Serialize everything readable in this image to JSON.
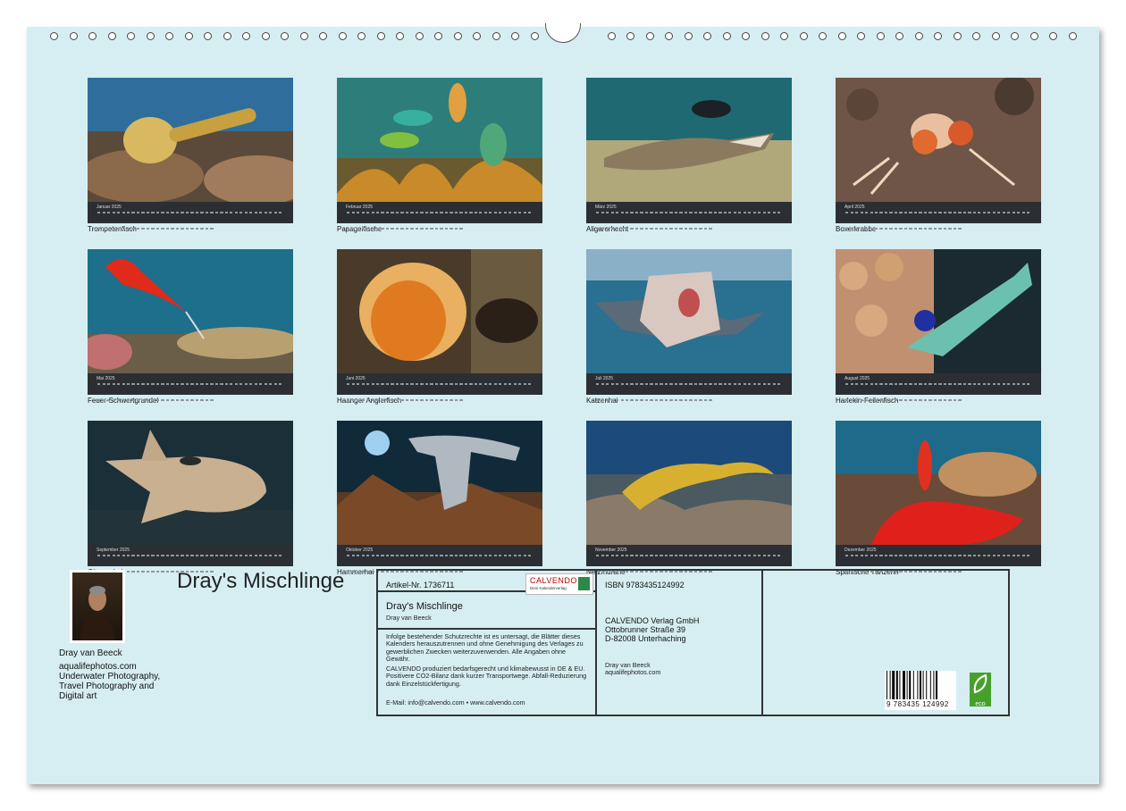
{
  "calendar": {
    "title": "Dray's Mischlinge",
    "months": [
      {
        "name": "Januar 2025",
        "caption": "Trompetenfisch"
      },
      {
        "name": "Februar 2025",
        "caption": "Papageifische"
      },
      {
        "name": "März 2025",
        "caption": "Aligarorhecht"
      },
      {
        "name": "April 2025",
        "caption": "Boxerkrabbe"
      },
      {
        "name": "Mai 2025",
        "caption": "Feuer-Schwertgrundel"
      },
      {
        "name": "Juni 2025",
        "caption": "Haanger Anglerfisch"
      },
      {
        "name": "Juli 2025",
        "caption": "Katzenhai"
      },
      {
        "name": "August 2025",
        "caption": "Harlekin-Feilenfisch"
      },
      {
        "name": "September 2025",
        "caption": "Gitarrenhai"
      },
      {
        "name": "Oktober 2025",
        "caption": "Hammerhai"
      },
      {
        "name": "November 2025",
        "caption": "Netzmuräne"
      },
      {
        "name": "Dezember 2025",
        "caption": "Spanische Tänzerin"
      }
    ]
  },
  "author": {
    "name": "Dray van Beeck",
    "website": "aqualifephotos.com",
    "desc1": "Underwater Photography,",
    "desc2": "Travel Photography and",
    "desc3": "Digital art"
  },
  "info": {
    "artikel": "Artikel-Nr. 1736711",
    "calvendo_name": "CALVENDO",
    "calvendo_sub": "Dein Kalenderverlag",
    "product_title": "Dray's Mischlinge",
    "product_author": "Dray van Beeck",
    "legal1": "Infolge bestehender Schutzrechte ist es untersagt, die Blätter dieses Kalenders herauszutrennen und ohne Genehmigung des Verlages zu gewerblichen Zwecken weiterzuverwenden. Alle Angaben ohne Gewähr.",
    "legal2": "CALVENDO produziert bedarfsgerecht und klimabewusst in DE & EU. Positivere CO2-Bilanz dank kurzer Transportwege. Abfall-Reduzierung dank Einzelstückfertigung.",
    "email": "E-Mail: info@calvendo.com • www.calvendo.com",
    "isbn": "ISBN 9783435124992",
    "publisher1": "CALVENDO Verlag GmbH",
    "publisher2": "Ottobrunner Straße 39",
    "publisher3": "D-82008 Unterhaching",
    "contact_name": "Dray van Beeck",
    "contact_site": "aqualifephotos.com",
    "barcode_digits": "9 783435 124992",
    "eco_label": "eco"
  }
}
